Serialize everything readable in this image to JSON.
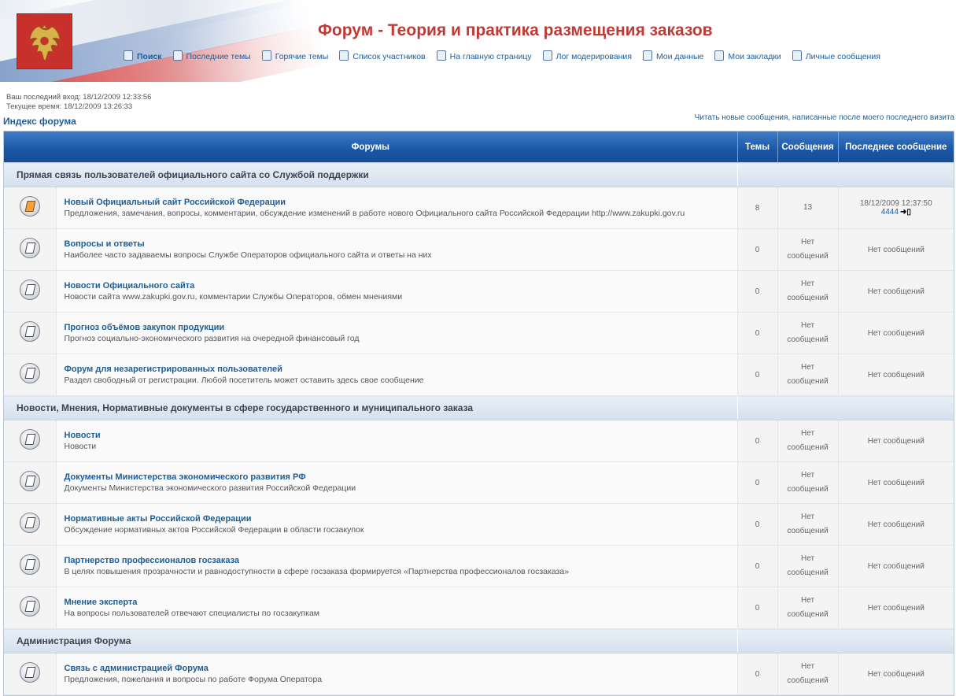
{
  "header": {
    "site_title": "Форум - Теория и практика размещения заказов",
    "nav": [
      {
        "label": "Поиск",
        "icon": "search-icon",
        "bold": true
      },
      {
        "label": "Последние темы",
        "icon": "topics-icon"
      },
      {
        "label": "Горячие темы",
        "icon": "hot-topics-icon"
      },
      {
        "label": "Список участников",
        "icon": "members-icon"
      },
      {
        "label": "На главную страницу",
        "icon": "home-icon"
      },
      {
        "label": "Лог модерирования",
        "icon": "log-icon"
      },
      {
        "label": "Мои данные",
        "icon": "profile-icon"
      },
      {
        "label": "Мои закладки",
        "icon": "bookmarks-icon"
      },
      {
        "label": "Личные сообщения",
        "icon": "messages-icon"
      }
    ]
  },
  "session": {
    "last_visit": "Ваш последний вход: 18/12/2009 12:33:56",
    "current_time": "Текущее время: 18/12/2009 13:26:33"
  },
  "index_link": "Индекс форума",
  "new_posts_link": "Читать новые сообщения, написанные после моего последнего визита",
  "columns": {
    "forums": "Форумы",
    "topics": "Темы",
    "posts": "Сообщения",
    "last_post": "Последнее сообщение"
  },
  "no_posts_line1": "Нет",
  "no_posts_line2": "сообщений",
  "no_posts_full": "Нет сообщений",
  "categories": [
    {
      "title": "Прямая связь пользователей официального сайта со Службой поддержки",
      "forums": [
        {
          "name": "Новый Официальный сайт Российской Федерации",
          "desc": "Предложения, замечания, вопросы, комментарии, обсуждение изменений в работе нового Официального сайта Российской Федерации http://www.zakupki.gov.ru",
          "topics": "8",
          "posts": "13",
          "last_date": "18/12/2009 12:37:50",
          "last_user": "4444",
          "has_new": true
        },
        {
          "name": "Вопросы и ответы",
          "desc": "Наиболее часто задаваемы вопросы Службе Операторов официального сайта и ответы на них",
          "topics": "0"
        },
        {
          "name": "Новости Официального сайта",
          "desc": "Новости сайта www.zakupki.gov.ru, комментарии Службы Операторов, обмен мнениями",
          "topics": "0"
        },
        {
          "name": "Прогноз объёмов закупок продукции",
          "desc": "Прогноз социально-экономического развития на очередной финансовый год",
          "topics": "0"
        },
        {
          "name": "Форум для незарегистрированных пользователей",
          "desc": "Раздел свободный от регистрации. Любой посетитель может оставить здесь свое сообщение",
          "topics": "0"
        }
      ]
    },
    {
      "title": "Новости, Мнения, Нормативные документы в сфере государственного и муниципального заказа",
      "forums": [
        {
          "name": "Новости",
          "desc": "Новости",
          "topics": "0"
        },
        {
          "name": "Документы Министерства экономического развития РФ",
          "desc": "Документы Министерства экономического развития Российской Федерации",
          "topics": "0"
        },
        {
          "name": "Нормативные акты Российской Федерации",
          "desc": "Обсуждение нормативных актов Российской Федерации в области госзакупок",
          "topics": "0"
        },
        {
          "name": "Партнерство профессионалов госзаказа",
          "desc": "В целях повышения прозрачности и равнодоступности в сфере госзаказа формируется «Партнерства профессионалов госзаказа»",
          "topics": "0"
        },
        {
          "name": "Мнение эксперта",
          "desc": "На вопросы пользователей отвечают специалисты по госзакупкам",
          "topics": "0"
        }
      ]
    },
    {
      "title": "Администрация Форума",
      "forums": [
        {
          "name": "Связь с администрацией Форума",
          "desc": "Предложения, пожелания и вопросы по работе Форума Оператора",
          "topics": "0"
        }
      ]
    }
  ]
}
